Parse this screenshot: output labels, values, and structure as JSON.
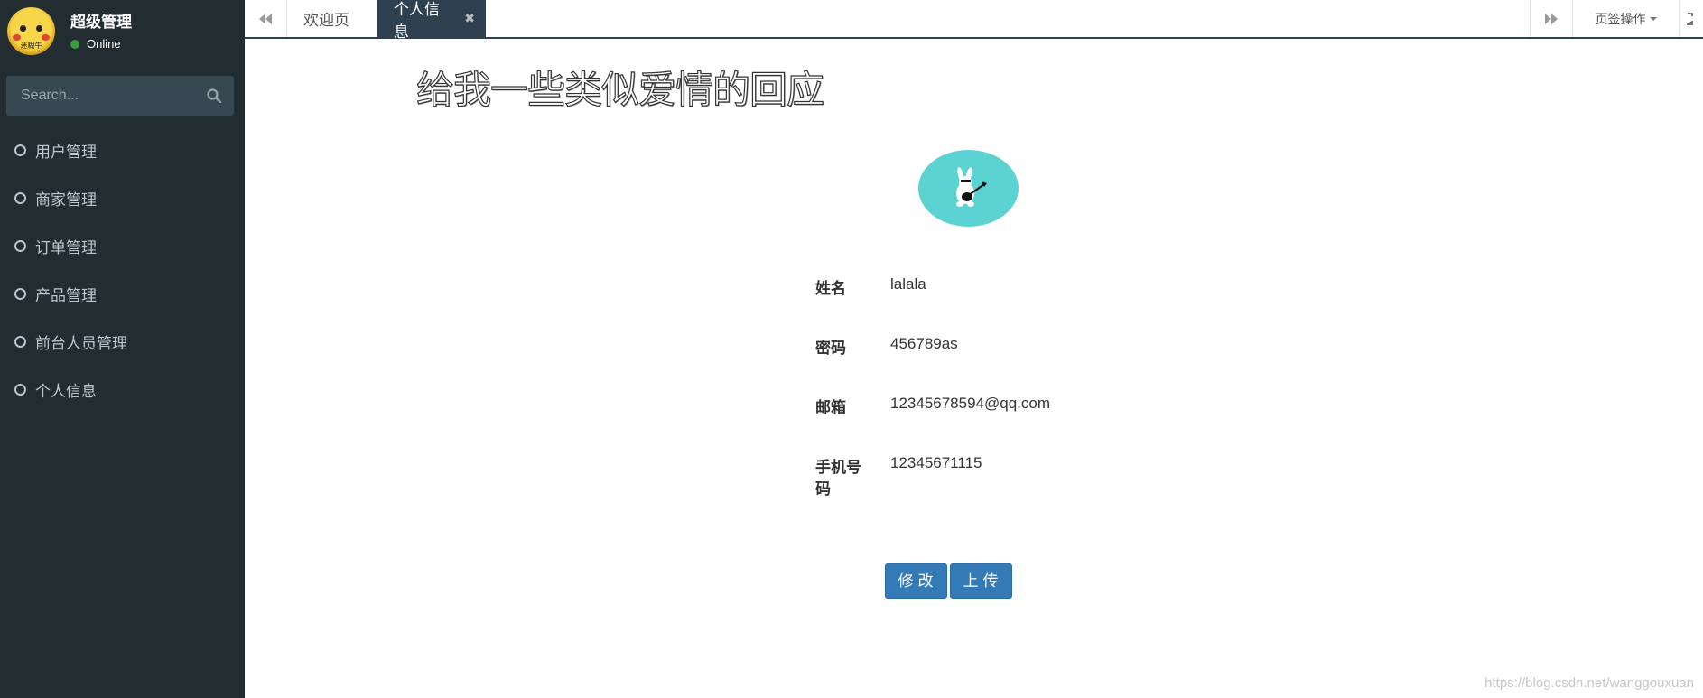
{
  "sidebar": {
    "user_name": "超级管理",
    "status": "Online",
    "avatar_tag": "迷糊牛",
    "search_placeholder": "Search...",
    "menu": [
      {
        "label": "用户管理"
      },
      {
        "label": "商家管理"
      },
      {
        "label": "订单管理"
      },
      {
        "label": "产品管理"
      },
      {
        "label": "前台人员管理"
      },
      {
        "label": "个人信息"
      }
    ]
  },
  "tabs": {
    "items": [
      {
        "label": "欢迎页"
      },
      {
        "label": "个人信息",
        "active": true
      }
    ],
    "ops_label": "页签操作"
  },
  "content": {
    "slogan": "给我一些类似爱情的回应",
    "fields": [
      {
        "label": "姓名",
        "value": "lalala"
      },
      {
        "label": "密码",
        "value": "456789as"
      },
      {
        "label": "邮箱",
        "value": "12345678594@qq.com"
      },
      {
        "label": "手机号码",
        "value": "12345671115"
      }
    ],
    "buttons": {
      "edit": "修改",
      "upload": "上传"
    }
  },
  "watermark": "https://blog.csdn.net/wanggouxuan",
  "colors": {
    "sidebar_bg": "#222d32",
    "active_tab": "#2f4050",
    "button": "#337ab7",
    "avatar_bg": "#5bd3d2"
  }
}
